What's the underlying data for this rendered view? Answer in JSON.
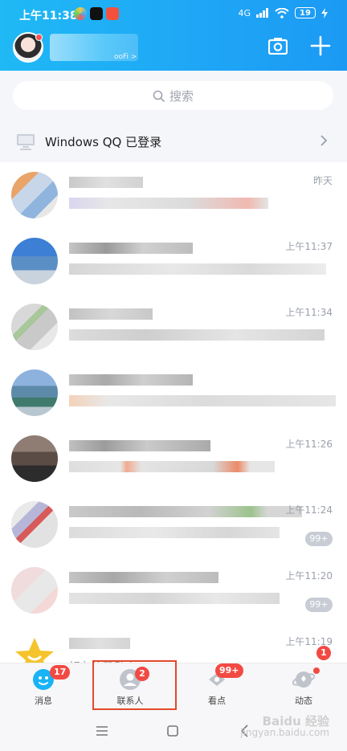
{
  "status_bar": {
    "time": "上午11:38",
    "network": "4G",
    "battery": "19"
  },
  "header": {
    "status_suffix": "ooFi >"
  },
  "search": {
    "placeholder": "搜索"
  },
  "banner": {
    "text": "Windows QQ 已登录"
  },
  "conversations": [
    {
      "time": "昨天",
      "unread": ""
    },
    {
      "time": "上午11:37",
      "unread": ""
    },
    {
      "time": "上午11:34",
      "unread": ""
    },
    {
      "time": "",
      "unread": ""
    },
    {
      "time": "上午11:26",
      "unread": ""
    },
    {
      "time": "上午11:24",
      "unread": "99+"
    },
    {
      "time": "上午11:20",
      "unread": "99+"
    },
    {
      "time": "上午11:19",
      "unread": "",
      "preview": "好友的新动态"
    }
  ],
  "tabs": [
    {
      "label": "消息",
      "badge": "17"
    },
    {
      "label": "联系人",
      "badge": "2"
    },
    {
      "label": "看点",
      "badge": "99+"
    },
    {
      "label": "动态",
      "badge": "1"
    }
  ],
  "watermark": {
    "brand": "Baidu 经验",
    "url": "jingyan.baidu.com"
  },
  "colors": {
    "header_gradient_start": "#1fb9f5",
    "header_gradient_end": "#1b9af3",
    "badge_red": "#f24a43",
    "highlight_box": "#e3492b"
  }
}
